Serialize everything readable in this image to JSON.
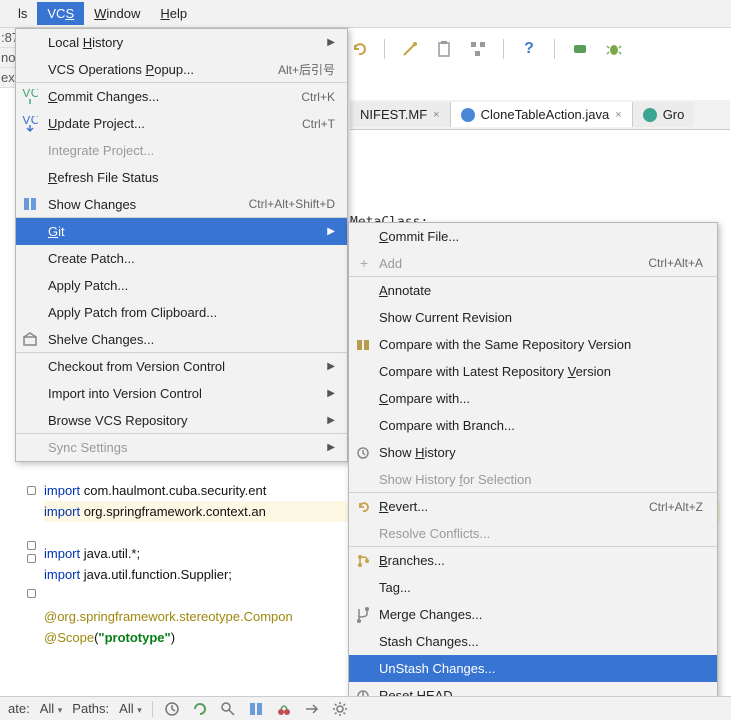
{
  "menubar": {
    "ls": "ls",
    "vcs": "VCS",
    "window": "Window",
    "help": "Help"
  },
  "left_strip": {
    "row1": ":87",
    "row2": "noc",
    "row3": "exc"
  },
  "toolbar_icons": [
    "undo",
    "wand",
    "clipboard",
    "structure",
    "help",
    "debug",
    "bug"
  ],
  "tabs": {
    "manifest": "NIFEST.MF",
    "clone": "CloneTableAction.java",
    "gro": "Gro"
  },
  "code_fragment": "MetaClass;",
  "editor": {
    "l1a": "import",
    "l1b": " com.haulmont.cuba.security.ent",
    "l2a": "import",
    "l2b": " org.springframework.context.an",
    "l3": "",
    "l4a": "import",
    "l4b": " java.util.*;",
    "l5a": "import",
    "l5b": " java.util.function.Supplier;",
    "l6": "",
    "l7a": "@org.springframework.stereotype.",
    "l7b": "Compon",
    "l8a": "@Scope",
    "l8b": "(",
    "l8c": "\"prototype\"",
    "l8d": ")"
  },
  "vcs_menu": [
    {
      "id": "local-history",
      "label": "Local History",
      "submenu": true,
      "mn": "H"
    },
    {
      "id": "vcs-ops",
      "label": "VCS Operations Popup...",
      "shortcut": "Alt+后引号",
      "mn": "P",
      "sep": true
    },
    {
      "id": "commit",
      "label": "Commit Changes...",
      "shortcut": "Ctrl+K",
      "icon": "vcs",
      "mn": "C"
    },
    {
      "id": "update",
      "label": "Update Project...",
      "shortcut": "Ctrl+T",
      "icon": "vcs-down",
      "mn": "U"
    },
    {
      "id": "integrate",
      "label": "Integrate Project...",
      "disabled": true
    },
    {
      "id": "refresh",
      "label": "Refresh File Status",
      "mn": "R"
    },
    {
      "id": "show-changes",
      "label": "Show Changes",
      "shortcut": "Ctrl+Alt+Shift+D",
      "icon": "diff",
      "sep": true
    },
    {
      "id": "git",
      "label": "Git",
      "submenu": true,
      "highlight": true,
      "mn": "G"
    },
    {
      "id": "create-patch",
      "label": "Create Patch..."
    },
    {
      "id": "apply-patch",
      "label": "Apply Patch..."
    },
    {
      "id": "apply-clip",
      "label": "Apply Patch from Clipboard..."
    },
    {
      "id": "shelve",
      "label": "Shelve Changes...",
      "icon": "shelve",
      "sep": true
    },
    {
      "id": "checkout",
      "label": "Checkout from Version Control",
      "submenu": true
    },
    {
      "id": "import-vc",
      "label": "Import into Version Control",
      "submenu": true
    },
    {
      "id": "browse-repo",
      "label": "Browse VCS Repository",
      "submenu": true,
      "sep": true
    },
    {
      "id": "sync",
      "label": "Sync Settings",
      "submenu": true,
      "disabled": true
    }
  ],
  "git_menu": [
    {
      "id": "commit-file",
      "label": "Commit File...",
      "mn": "C"
    },
    {
      "id": "add",
      "label": "Add",
      "shortcut": "Ctrl+Alt+A",
      "icon": "plus",
      "disabled": true,
      "sep": true
    },
    {
      "id": "annotate",
      "label": "Annotate",
      "mn": "A"
    },
    {
      "id": "show-current",
      "label": "Show Current Revision"
    },
    {
      "id": "cmp-same",
      "label": "Compare with the Same Repository Version",
      "icon": "compare"
    },
    {
      "id": "cmp-latest",
      "label": "Compare with Latest Repository Version",
      "mn": "V"
    },
    {
      "id": "cmp-with",
      "label": "Compare with...",
      "mn": "C"
    },
    {
      "id": "cmp-branch",
      "label": "Compare with Branch..."
    },
    {
      "id": "show-hist",
      "label": "Show History",
      "icon": "history",
      "mn": "H"
    },
    {
      "id": "show-hist-sel",
      "label": "Show History for Selection",
      "disabled": true,
      "sep": true,
      "mn": "f"
    },
    {
      "id": "revert",
      "label": "Revert...",
      "shortcut": "Ctrl+Alt+Z",
      "icon": "revert",
      "mn": "R"
    },
    {
      "id": "resolve",
      "label": "Resolve Conflicts...",
      "disabled": true,
      "sep": true
    },
    {
      "id": "branches",
      "label": "Branches...",
      "icon": "branch",
      "mn": "B"
    },
    {
      "id": "tag",
      "label": "Tag..."
    },
    {
      "id": "merge",
      "label": "Merge Changes...",
      "icon": "merge"
    },
    {
      "id": "stash",
      "label": "Stash Changes..."
    },
    {
      "id": "unstash",
      "label": "UnStash Changes...",
      "highlight": true
    },
    {
      "id": "reset",
      "label": "Reset HEAD...",
      "icon": "reset"
    }
  ],
  "status": {
    "ate": "ate:",
    "all1": "All",
    "paths": "Paths:",
    "all2": "All"
  }
}
